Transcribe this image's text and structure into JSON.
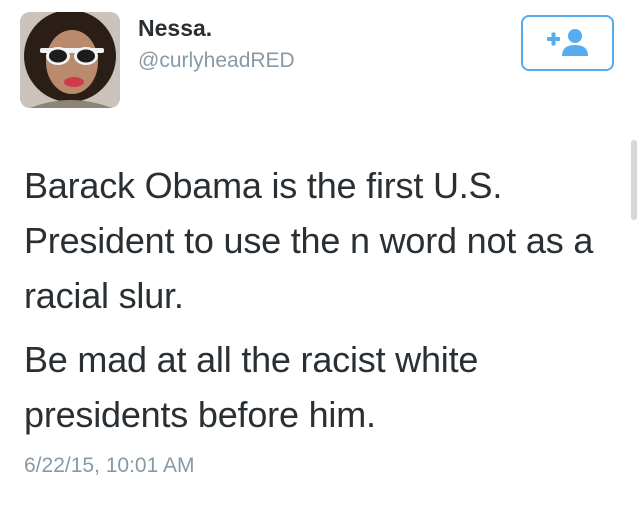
{
  "tweet": {
    "author": {
      "display_name": "Nessa.",
      "handle": "@curlyheadRED",
      "avatar_icon": "profile-photo"
    },
    "follow_button": {
      "icon": "add-user-icon",
      "color": "#55acee"
    },
    "paragraphs": [
      "Barack Obama is the first U.S. President to use the n word not as a racial slur.",
      "Be mad at all the racist white presidents before him."
    ],
    "timestamp": "6/22/15, 10:01 AM"
  },
  "colors": {
    "text": "#292f33",
    "secondary_text": "#8899a6",
    "accent": "#55acee"
  }
}
